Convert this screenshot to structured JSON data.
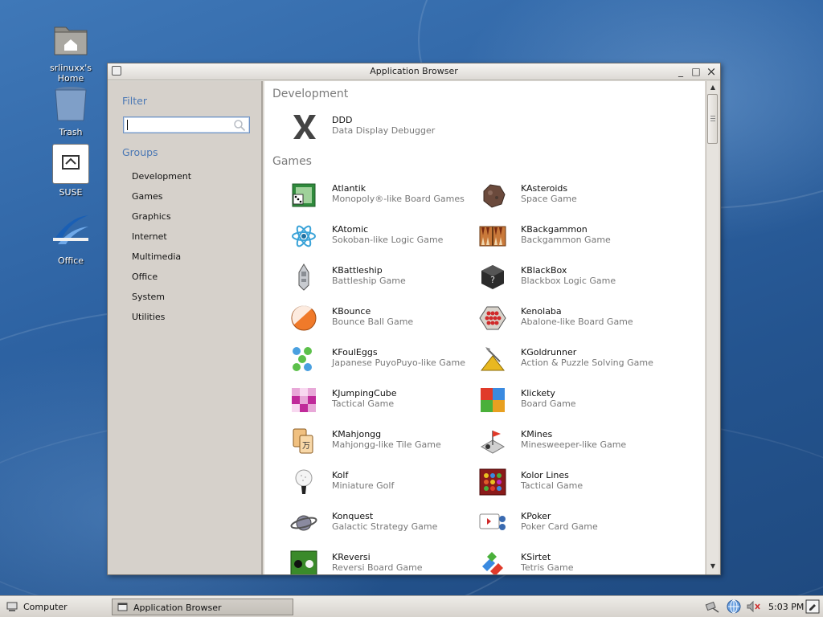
{
  "desktop": {
    "icons": [
      {
        "label": "srlinuxx's Home",
        "icon": "home-folder-icon"
      },
      {
        "label": "Trash",
        "icon": "trash-icon"
      },
      {
        "label": "SUSE",
        "icon": "suse-document-icon"
      },
      {
        "label": "Office",
        "icon": "office-icon"
      }
    ]
  },
  "window": {
    "title": "Application Browser",
    "controls": {
      "minimize": "_",
      "maximize": "□",
      "close": "×"
    }
  },
  "sidebar": {
    "filter_heading": "Filter",
    "search": {
      "value": "",
      "placeholder": ""
    },
    "groups_heading": "Groups",
    "groups": [
      "Development",
      "Games",
      "Graphics",
      "Internet",
      "Multimedia",
      "Office",
      "System",
      "Utilities"
    ]
  },
  "content": {
    "sections": [
      {
        "heading": "Development",
        "apps": [
          {
            "name": "DDD",
            "desc": "Data Display Debugger",
            "icon": "ddd-icon"
          }
        ]
      },
      {
        "heading": "Games",
        "apps": [
          {
            "name": "Atlantik",
            "desc": "Monopoly®-like Board Games",
            "icon": "atlantik-icon"
          },
          {
            "name": "KAsteroids",
            "desc": "Space Game",
            "icon": "kasteroids-icon"
          },
          {
            "name": "KAtomic",
            "desc": "Sokoban-like Logic Game",
            "icon": "katomic-icon"
          },
          {
            "name": "KBackgammon",
            "desc": "Backgammon Game",
            "icon": "kbackgammon-icon"
          },
          {
            "name": "KBattleship",
            "desc": "Battleship Game",
            "icon": "kbattleship-icon"
          },
          {
            "name": "KBlackBox",
            "desc": "Blackbox Logic Game",
            "icon": "kblackbox-icon"
          },
          {
            "name": "KBounce",
            "desc": "Bounce Ball Game",
            "icon": "kbounce-icon"
          },
          {
            "name": "Kenolaba",
            "desc": "Abalone-like Board Game",
            "icon": "kenolaba-icon"
          },
          {
            "name": "KFoulEggs",
            "desc": "Japanese PuyoPuyo-like Game",
            "icon": "kfouleggs-icon"
          },
          {
            "name": "KGoldrunner",
            "desc": "Action & Puzzle Solving Game",
            "icon": "kgoldrunner-icon"
          },
          {
            "name": "KJumpingCube",
            "desc": "Tactical Game",
            "icon": "kjumpingcube-icon"
          },
          {
            "name": "Klickety",
            "desc": "Board Game",
            "icon": "klickety-icon"
          },
          {
            "name": "KMahjongg",
            "desc": "Mahjongg-like Tile Game",
            "icon": "kmahjongg-icon"
          },
          {
            "name": "KMines",
            "desc": "Minesweeper-like Game",
            "icon": "kmines-icon"
          },
          {
            "name": "Kolf",
            "desc": "Miniature Golf",
            "icon": "kolf-icon"
          },
          {
            "name": "Kolor Lines",
            "desc": "Tactical Game",
            "icon": "kolor-lines-icon"
          },
          {
            "name": "Konquest",
            "desc": "Galactic Strategy Game",
            "icon": "konquest-icon"
          },
          {
            "name": "KPoker",
            "desc": "Poker Card Game",
            "icon": "kpoker-icon"
          },
          {
            "name": "KReversi",
            "desc": "Reversi Board Game",
            "icon": "kreversi-icon"
          },
          {
            "name": "KSirtet",
            "desc": "Tetris Game",
            "icon": "ksirtet-icon"
          }
        ]
      }
    ]
  },
  "taskbar": {
    "computer_label": "Computer",
    "task_label": "Application Browser",
    "clock": "5:03 PM",
    "tray_icons": [
      "network-icon",
      "globe-update-icon",
      "volume-muted-icon",
      "notes-icon"
    ]
  }
}
